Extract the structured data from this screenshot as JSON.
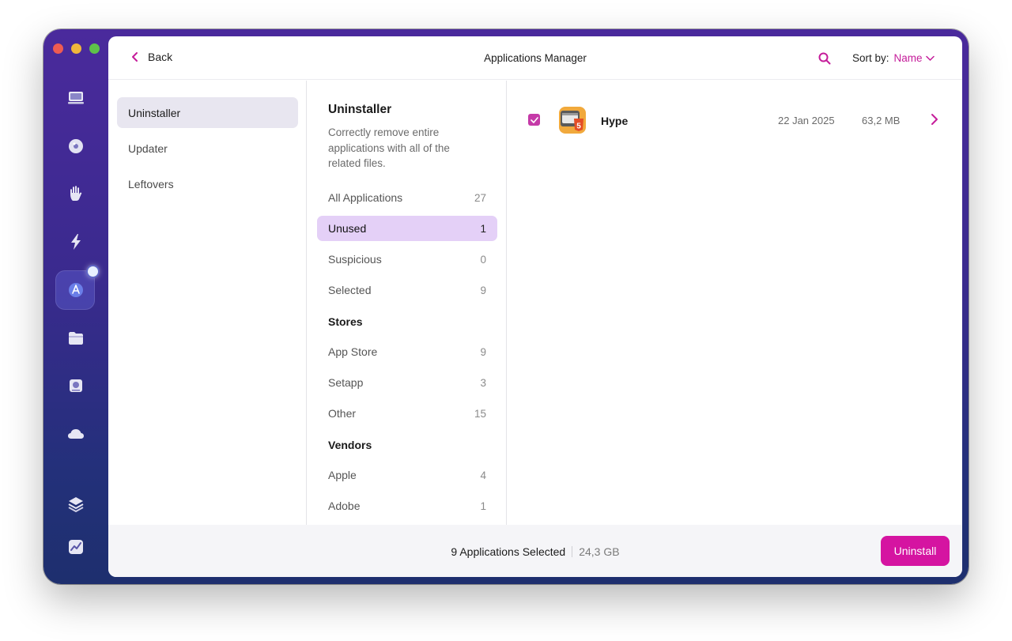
{
  "header": {
    "back_label": "Back",
    "title": "Applications Manager",
    "sort_label": "Sort by:",
    "sort_value": "Name"
  },
  "rail": {
    "icons": [
      "monitor-icon",
      "disk-cleanup-icon",
      "hand-privacy-icon",
      "lightning-speed-icon",
      "applications-icon",
      "folder-icon",
      "shredder-icon",
      "cloud-icon",
      "layers-icon",
      "chart-icon"
    ],
    "active_index": 4
  },
  "left_nav": {
    "items": [
      {
        "label": "Uninstaller",
        "active": true
      },
      {
        "label": "Updater",
        "active": false
      },
      {
        "label": "Leftovers",
        "active": false
      }
    ]
  },
  "middle": {
    "title": "Uninstaller",
    "description": "Correctly remove entire applications with all of the related files.",
    "filters": [
      {
        "label": "All Applications",
        "count": "27"
      },
      {
        "label": "Unused",
        "count": "1",
        "active": true
      },
      {
        "label": "Suspicious",
        "count": "0"
      },
      {
        "label": "Selected",
        "count": "9"
      }
    ],
    "stores_heading": "Stores",
    "stores": [
      {
        "label": "App Store",
        "count": "9"
      },
      {
        "label": "Setapp",
        "count": "3"
      },
      {
        "label": "Other",
        "count": "15"
      }
    ],
    "vendors_heading": "Vendors",
    "vendors": [
      {
        "label": "Apple",
        "count": "4"
      },
      {
        "label": "Adobe",
        "count": "1"
      }
    ]
  },
  "apps": [
    {
      "name": "Hype",
      "date": "22 Jan 2025",
      "size": "63,2 MB",
      "checked": true
    }
  ],
  "footer": {
    "selection": "9 Applications Selected",
    "total_size": "24,3 GB",
    "uninstall_label": "Uninstall"
  },
  "colors": {
    "accent": "#d514a1",
    "active_filter": "#e4d0f7",
    "sidebar_gradient_top": "#4a2a9c",
    "sidebar_gradient_bottom": "#1e2f6e"
  }
}
